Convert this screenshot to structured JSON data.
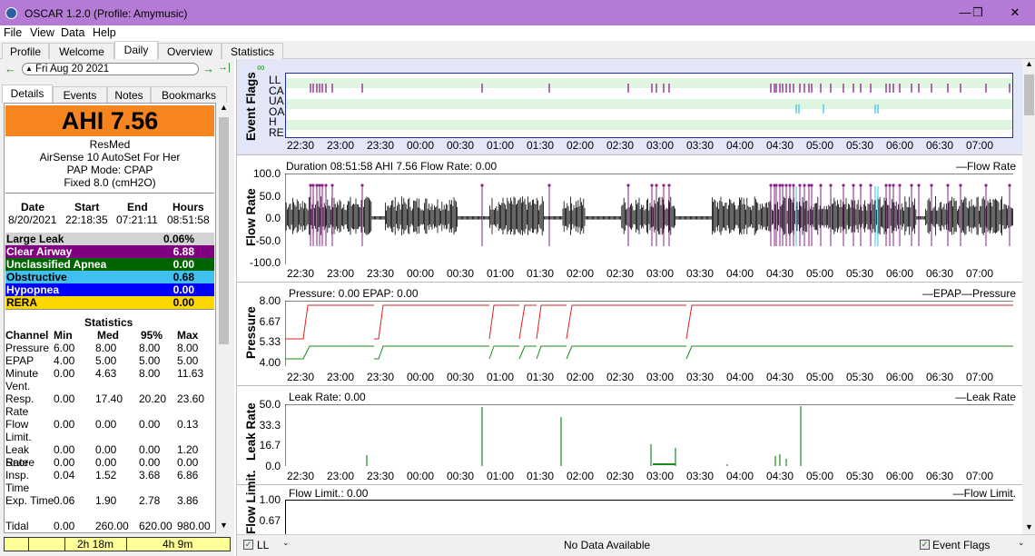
{
  "window": {
    "title": "OSCAR 1.2.0 (Profile: Amymusic)",
    "min": "—",
    "restore": "❐",
    "close": "✕"
  },
  "menu": [
    "File",
    "View",
    "Data",
    "Help"
  ],
  "tabs": [
    "Profile",
    "Welcome",
    "Daily",
    "Overview",
    "Statistics"
  ],
  "active_tab": "Daily",
  "datenav": {
    "date": "Fri Aug 20 2021",
    "prev": "←",
    "next": "→",
    "last": "→|",
    "cal": "▲"
  },
  "left_tabs": [
    "Details",
    "Events",
    "Notes",
    "Bookmarks"
  ],
  "summary": {
    "ahi": "AHI 7.56",
    "brand": "ResMed",
    "model": "AirSense 10 AutoSet For Her",
    "mode": "PAP Mode: CPAP",
    "fixed": "Fixed 8.0 (cmH2O)",
    "session_headers": [
      "Date",
      "Start",
      "End",
      "Hours"
    ],
    "session_values": [
      "8/20/2021",
      "22:18:35",
      "07:21:11",
      "08:51:58"
    ],
    "events": [
      {
        "label": "Large Leak",
        "value": "0.06%",
        "bg": "#d3d3d3",
        "fg": "#000000"
      },
      {
        "label": "Clear Airway",
        "value": "6.88",
        "bg": "#800080",
        "fg": "#ffffff"
      },
      {
        "label": "Unclassified Apnea",
        "value": "0.00",
        "bg": "#006400",
        "fg": "#ffffff"
      },
      {
        "label": "Obstructive",
        "value": "0.68",
        "bg": "#40c0f0",
        "fg": "#000000"
      },
      {
        "label": "Hypopnea",
        "value": "0.00",
        "bg": "#0000ff",
        "fg": "#ffffff"
      },
      {
        "label": "RERA",
        "value": "0.00",
        "bg": "#ffd700",
        "fg": "#000000"
      }
    ],
    "stats_title": "Statistics",
    "stats_headers": [
      "Channel",
      "Min",
      "Med",
      "95%",
      "Max"
    ],
    "stats_rows": [
      [
        "Pressure",
        "6.00",
        "8.00",
        "8.00",
        "8.00"
      ],
      [
        "EPAP",
        "4.00",
        "5.00",
        "5.00",
        "5.00"
      ],
      [
        "Minute Vent.",
        "0.00",
        "4.63",
        "8.00",
        "11.63"
      ],
      [
        "Resp. Rate",
        "0.00",
        "17.40",
        "20.20",
        "23.60"
      ],
      [
        "Flow Limit.",
        "0.00",
        "0.00",
        "0.00",
        "0.13"
      ],
      [
        "Leak Rate",
        "0.00",
        "0.00",
        "0.00",
        "1.20"
      ],
      [
        "Snore",
        "0.00",
        "0.00",
        "0.00",
        "0.00"
      ],
      [
        "Insp. Time",
        "0.04",
        "1.52",
        "3.68",
        "6.86"
      ],
      [
        "Exp. Time",
        "0.06",
        "1.90",
        "2.78",
        "3.86"
      ],
      [
        "Tidal Volume",
        "0.00",
        "260.00",
        "620.00",
        "980.00"
      ]
    ],
    "bar_left": "2h 18m",
    "bar_right": "4h 9m"
  },
  "charts": {
    "xticks": [
      "22:30",
      "23:00",
      "23:30",
      "00:00",
      "00:30",
      "01:00",
      "01:30",
      "02:00",
      "02:30",
      "03:00",
      "03:30",
      "04:00",
      "04:30",
      "05:00",
      "05:30",
      "06:00",
      "06:30",
      "07:00"
    ],
    "event_flags": {
      "ylabel": "Event Flags",
      "rows": [
        "LL",
        "CA",
        "UA",
        "OA",
        "H",
        "RE"
      ]
    },
    "flow": {
      "ylabel": "Flow Rate",
      "title": "Duration 08:51:58 AHI 7.56 Flow Rate: 0.00",
      "legend": "—Flow Rate",
      "yticks": [
        "100.0",
        "50.0",
        "0.0",
        "-50.0",
        "-100.0"
      ]
    },
    "pressure": {
      "ylabel": "Pressure",
      "title": "Pressure: 0.00 EPAP: 0.00",
      "legend": "—EPAP—Pressure",
      "yticks": [
        "8.00",
        "6.67",
        "5.33",
        "4.00"
      ],
      "epap_color": "#1a8a1a",
      "pressure_color": "#e02020"
    },
    "leak": {
      "ylabel": "Leak Rate",
      "title": "Leak Rate: 0.00",
      "legend": "—Leak Rate",
      "yticks": [
        "50.0",
        "33.3",
        "16.7",
        "0.0"
      ]
    },
    "flowlimit": {
      "ylabel": "Flow Limit.",
      "title": "Flow Limit.: 0.00",
      "legend": "—Flow Limit.",
      "yticks": [
        "1.00",
        "0.67"
      ]
    }
  },
  "statusbar": {
    "left": "LL",
    "center": "No Data Available",
    "right": "Event Flags"
  }
}
